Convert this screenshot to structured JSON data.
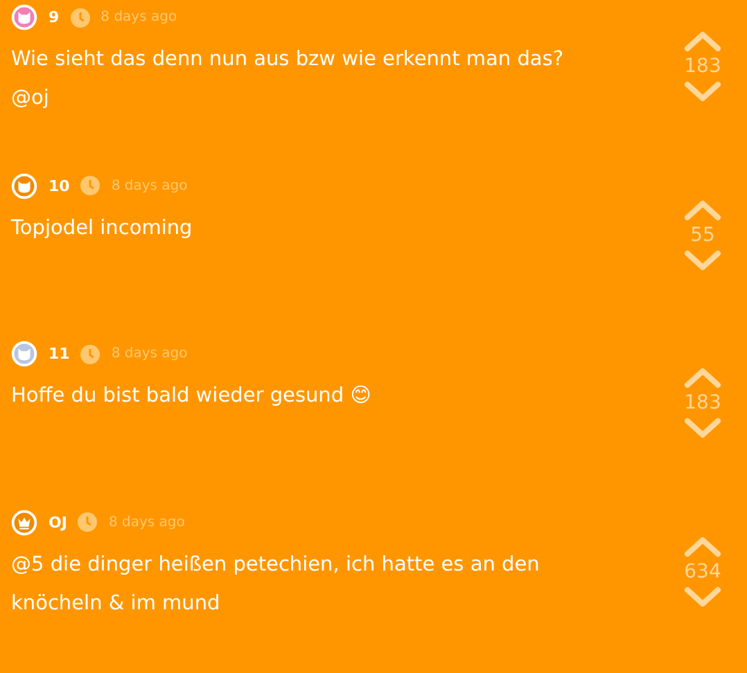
{
  "replies": [
    {
      "author": "9",
      "avatar": {
        "kind": "cat",
        "color": "#f27fb3"
      },
      "time": "8 days ago",
      "text": "Wie sieht das denn nun aus bzw wie erkennt man das? @oj",
      "votes": "183"
    },
    {
      "author": "10",
      "avatar": {
        "kind": "cat",
        "color": "#f08a00"
      },
      "time": "8 days ago",
      "text": "Topjodel incoming",
      "votes": "55"
    },
    {
      "author": "11",
      "avatar": {
        "kind": "cat",
        "color": "#b9c6e0"
      },
      "time": "8 days ago",
      "text": "Hoffe du bist bald wieder gesund 😊",
      "votes": "183"
    },
    {
      "author": "OJ",
      "avatar": {
        "kind": "crown",
        "color": "#f08a00"
      },
      "time": "8 days ago",
      "text": "@5 die dinger heißen petechien, ich hatte es an den knöcheln & im mund",
      "votes": "634"
    }
  ]
}
